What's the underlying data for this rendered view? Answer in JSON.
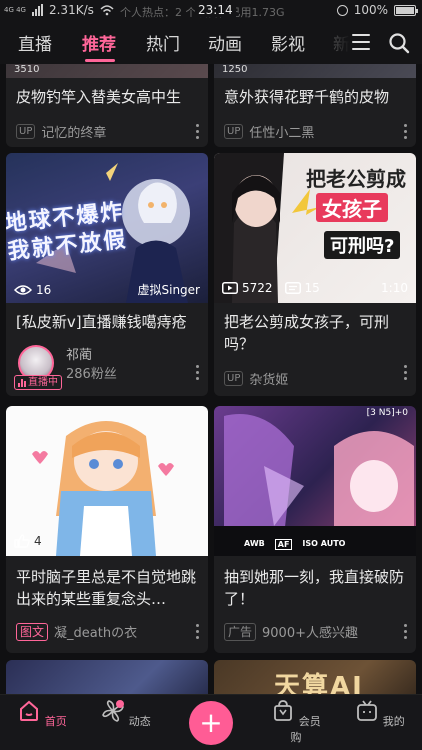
{
  "status_bar": {
    "network": "4G 4G",
    "speed": "2.31K/s",
    "center_text": "个人热点：2 个设备，已用1.73G",
    "time": "23:14",
    "battery": "100%"
  },
  "tabs": [
    {
      "label": "直播",
      "active": false
    },
    {
      "label": "推荐",
      "active": true
    },
    {
      "label": "热门",
      "active": false
    },
    {
      "label": "动画",
      "active": false
    },
    {
      "label": "影视",
      "active": false
    },
    {
      "label": "新",
      "active": false
    }
  ],
  "feed": {
    "cards": [
      {
        "title": "皮物钓竿入替美女高中生",
        "author": "记忆的终章",
        "tag": "UP",
        "top_stats": "3510"
      },
      {
        "title": "意外获得花野千鹤的皮物",
        "author": "任性小二黑",
        "tag": "UP",
        "top_stats": "1250"
      },
      {
        "title": "[私皮新v]直播赚钱噶痔疮",
        "views": "16",
        "thumb_caption": "虚拟Singer",
        "thumb_text": "地球不爆炸 我就不放假",
        "streamer_name": "祁蔺",
        "fans": "286粉丝",
        "live_badge": "直播中"
      },
      {
        "title": "把老公剪成女孩子，可刑吗？",
        "views": "5722",
        "comments": "15",
        "duration": "1:10",
        "thumb_text_line1": "把老公剪成",
        "thumb_text_line2": "女孩子",
        "thumb_text_line3": "可刑吗?",
        "author": "杂货姬",
        "tag": "UP"
      },
      {
        "title": "平时脑子里总是不自觉地跳出来的某些重复念头…",
        "likes": "4",
        "tag": "图文",
        "author": "凝_deathの衣"
      },
      {
        "title": "抽到她那一刻，我直接破防了！",
        "tag": "广告",
        "author": "9000+人感兴趣",
        "camera_labels": [
          "AWB",
          "AF",
          "ISO AUTO"
        ],
        "camera_status": "[3 N5]+0"
      },
      {
        "title": "",
        "thumb_text": "天算AI"
      }
    ]
  },
  "bottom_nav": [
    {
      "label": "首页",
      "icon": "home-icon",
      "active": true
    },
    {
      "label": "动态",
      "icon": "dynamic-icon",
      "active": false
    },
    {
      "label": "+",
      "icon": "plus-icon",
      "active": false
    },
    {
      "label": "会员购",
      "icon": "shopping-bag-icon",
      "active": false
    },
    {
      "label": "我的",
      "icon": "tv-icon",
      "active": false
    }
  ],
  "colors": {
    "accent": "#ff6699",
    "background": "#101012",
    "card": "#1e1e20"
  }
}
